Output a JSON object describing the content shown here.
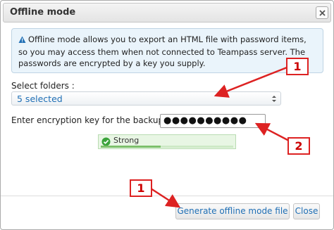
{
  "dialog": {
    "title": "Offline mode",
    "close_icon": "close-icon"
  },
  "notice": {
    "icon": "warning-icon",
    "text": "Offline mode allows you to export an HTML file with password items, so you may access them when not connected to Teampass server. The passwords are encrypted by a key you supply."
  },
  "folders": {
    "label": "Select folders :",
    "selected_value": "5 selected",
    "arrows_icon": "select-arrows-icon"
  },
  "encryption": {
    "label": "Enter encryption key for the backup. :",
    "masked_value": "●●●●●●●●●●"
  },
  "strength": {
    "icon": "check-circle-icon",
    "label": "Strong",
    "level": 0.45
  },
  "buttons": {
    "generate_label": "Generate offline mode file",
    "close_label": "Close"
  },
  "annotations": {
    "badge_folders": "1",
    "badge_key": "2",
    "badge_generate": "1",
    "color": "#dd2222"
  }
}
